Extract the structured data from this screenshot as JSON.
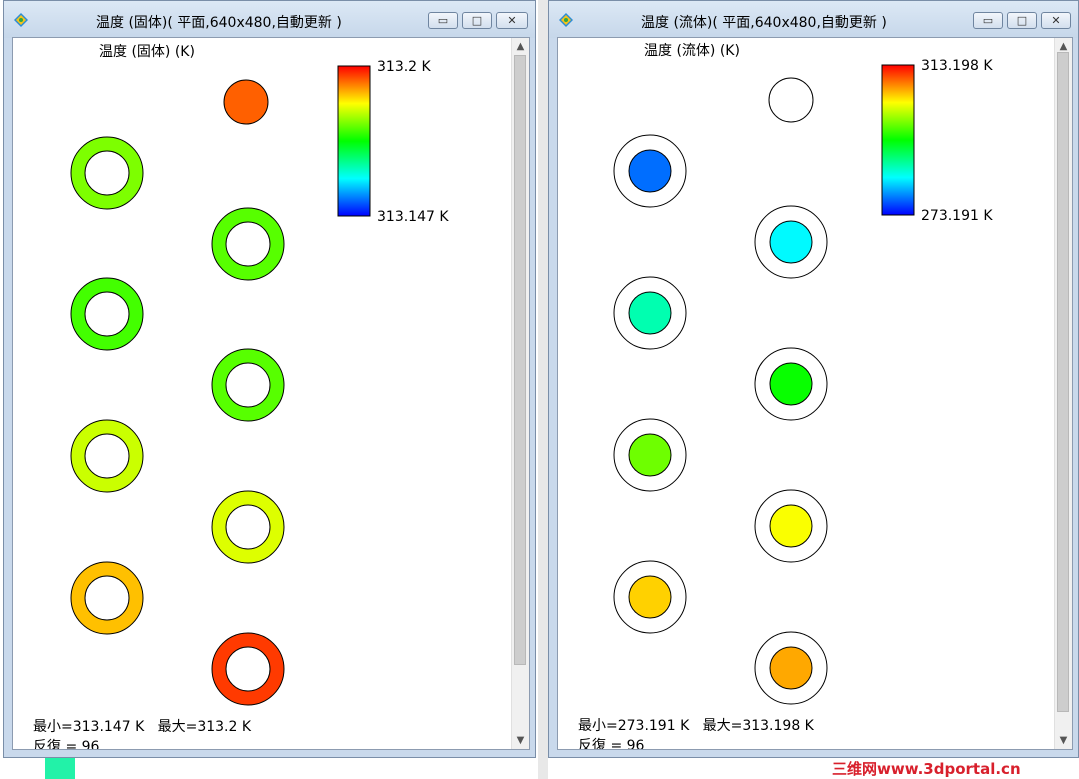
{
  "left_window": {
    "title": "温度 (固体)( 平面,640x480,自動更新 )",
    "plot_label": "温度 (固体) (K)",
    "legend_max": "313.2 K",
    "legend_min": "313.147 K",
    "stat_line": "最小=313.147 K   最大=313.2 K",
    "iter_line": "反復 = 96",
    "min_K": 313.147,
    "max_K": 313.2,
    "items": [
      {
        "kind": "disc",
        "temp_K": 313.195
      },
      {
        "kind": "ring",
        "temp_K": 313.18
      },
      {
        "kind": "ring",
        "temp_K": 313.178
      },
      {
        "kind": "ring",
        "temp_K": 313.177
      },
      {
        "kind": "ring",
        "temp_K": 313.178
      },
      {
        "kind": "ring",
        "temp_K": 313.184
      },
      {
        "kind": "ring",
        "temp_K": 313.185
      },
      {
        "kind": "ring",
        "temp_K": 313.19
      },
      {
        "kind": "ring",
        "temp_K": 313.197
      }
    ]
  },
  "right_window": {
    "title": "温度 (流体)( 平面,640x480,自動更新 )",
    "plot_label": "温度 (流体) (K)",
    "legend_max": "313.198 K",
    "legend_min": "273.191 K",
    "stat_line": "最小=273.191 K   最大=313.198 K",
    "iter_line": "反復 = 96",
    "min_K": 273.191,
    "max_K": 313.198,
    "items": [
      {
        "kind": "empty",
        "temp_K": null
      },
      {
        "kind": "channel",
        "temp_K": 277.5
      },
      {
        "kind": "channel",
        "temp_K": 283.0
      },
      {
        "kind": "channel",
        "temp_K": 286.3
      },
      {
        "kind": "channel",
        "temp_K": 293.5
      },
      {
        "kind": "channel",
        "temp_K": 297.5
      },
      {
        "kind": "channel",
        "temp_K": 303.0
      },
      {
        "kind": "channel",
        "temp_K": 305.0
      },
      {
        "kind": "channel",
        "temp_K": 306.6
      }
    ]
  },
  "controls": {
    "minimize": "▭",
    "maximize": "□",
    "close": "✕"
  },
  "watermark": "三维网www.3dportal.cn",
  "colors": {
    "titlebar": "#c9d9ec",
    "client": "#ffffff",
    "watermark": "#d8202c"
  }
}
